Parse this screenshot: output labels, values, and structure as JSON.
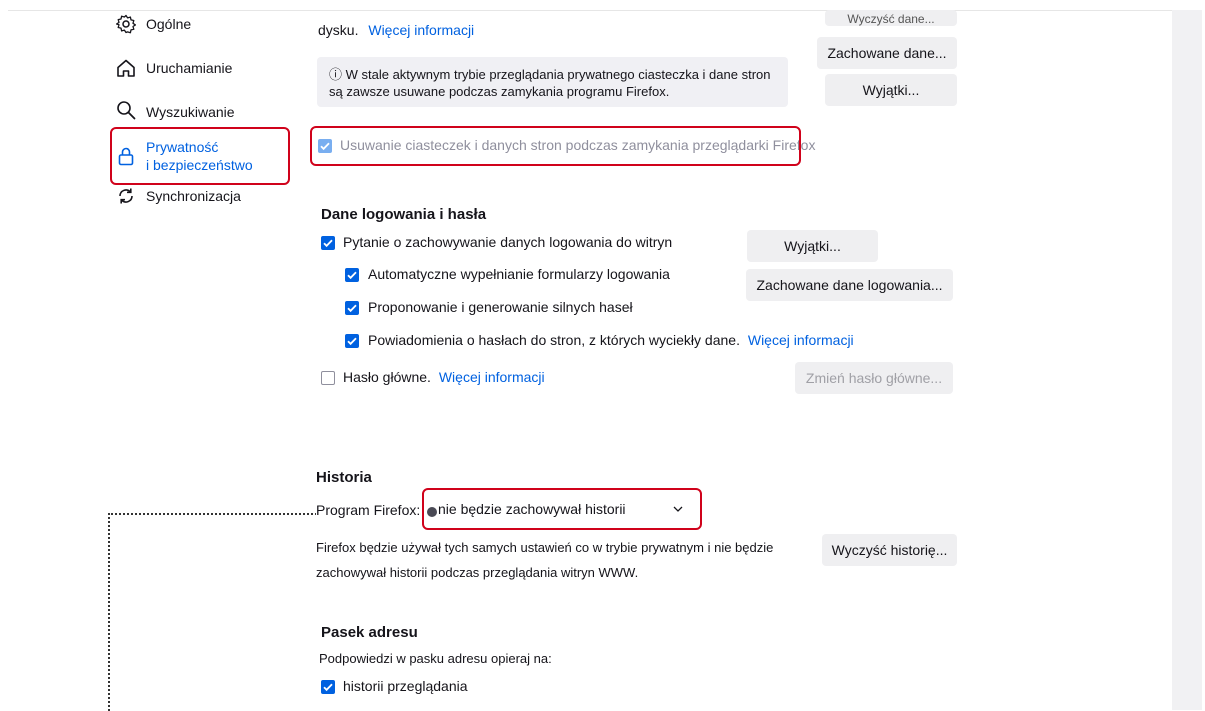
{
  "sidebar": {
    "items": [
      {
        "label": "Ogólne",
        "icon": "gear-icon"
      },
      {
        "label": "Uruchamianie",
        "icon": "home-icon"
      },
      {
        "label": "Wyszukiwanie",
        "icon": "search-icon"
      },
      {
        "label_line1": "Prywatność",
        "label_line2": "i bezpieczeństwo",
        "icon": "lock-icon",
        "active": true
      },
      {
        "label": "Synchronizacja",
        "icon": "sync-icon"
      }
    ]
  },
  "cookies": {
    "disk_text": "dysku.",
    "more_info": "Więcej informacji",
    "clear_data_button": "Wyczyść dane...",
    "saved_data_button": "Zachowane dane...",
    "exceptions_button": "Wyjątki...",
    "notice": "ⓘ W stale aktywnym trybie przeglądania prywatnego ciasteczka i dane stron są zawsze usuwane podczas zamykania programu Firefox.",
    "delete_on_close_label": "Usuwanie ciasteczek i danych stron podczas zamykania przeglądarki Firefox"
  },
  "logins": {
    "heading": "Dane logowania i hasła",
    "ask_save_label": "Pytanie o zachowywanie danych logowania do witryn",
    "autofill_label": "Automatyczne wypełnianie formularzy logowania",
    "suggest_label": "Proponowanie i generowanie silnych haseł",
    "breach_label": "Powiadomienia o hasłach do stron, z których wyciekły dane.",
    "breach_more_info": "Więcej informacji",
    "master_label": "Hasło główne.",
    "master_more_info": "Więcej informacji",
    "exceptions_button": "Wyjątki...",
    "saved_logins_button": "Zachowane dane logowania...",
    "change_master_button": "Zmień hasło główne..."
  },
  "history": {
    "heading": "Historia",
    "program_label": "Program Firefox:",
    "select_value": "nie będzie zachowywał historii",
    "description_line1": "Firefox będzie używał tych samych ustawień co w trybie prywatnym i nie będzie",
    "description_line2": "zachowywał historii podczas przeglądania witryn WWW.",
    "clear_button": "Wyczyść historię..."
  },
  "address_bar": {
    "heading": "Pasek adresu",
    "suggest_label": "Podpowiedzi w pasku adresu opieraj na:",
    "history_label": "historii przeglądania"
  },
  "colors": {
    "accent": "#0061e0",
    "highlight": "#d0021b"
  }
}
